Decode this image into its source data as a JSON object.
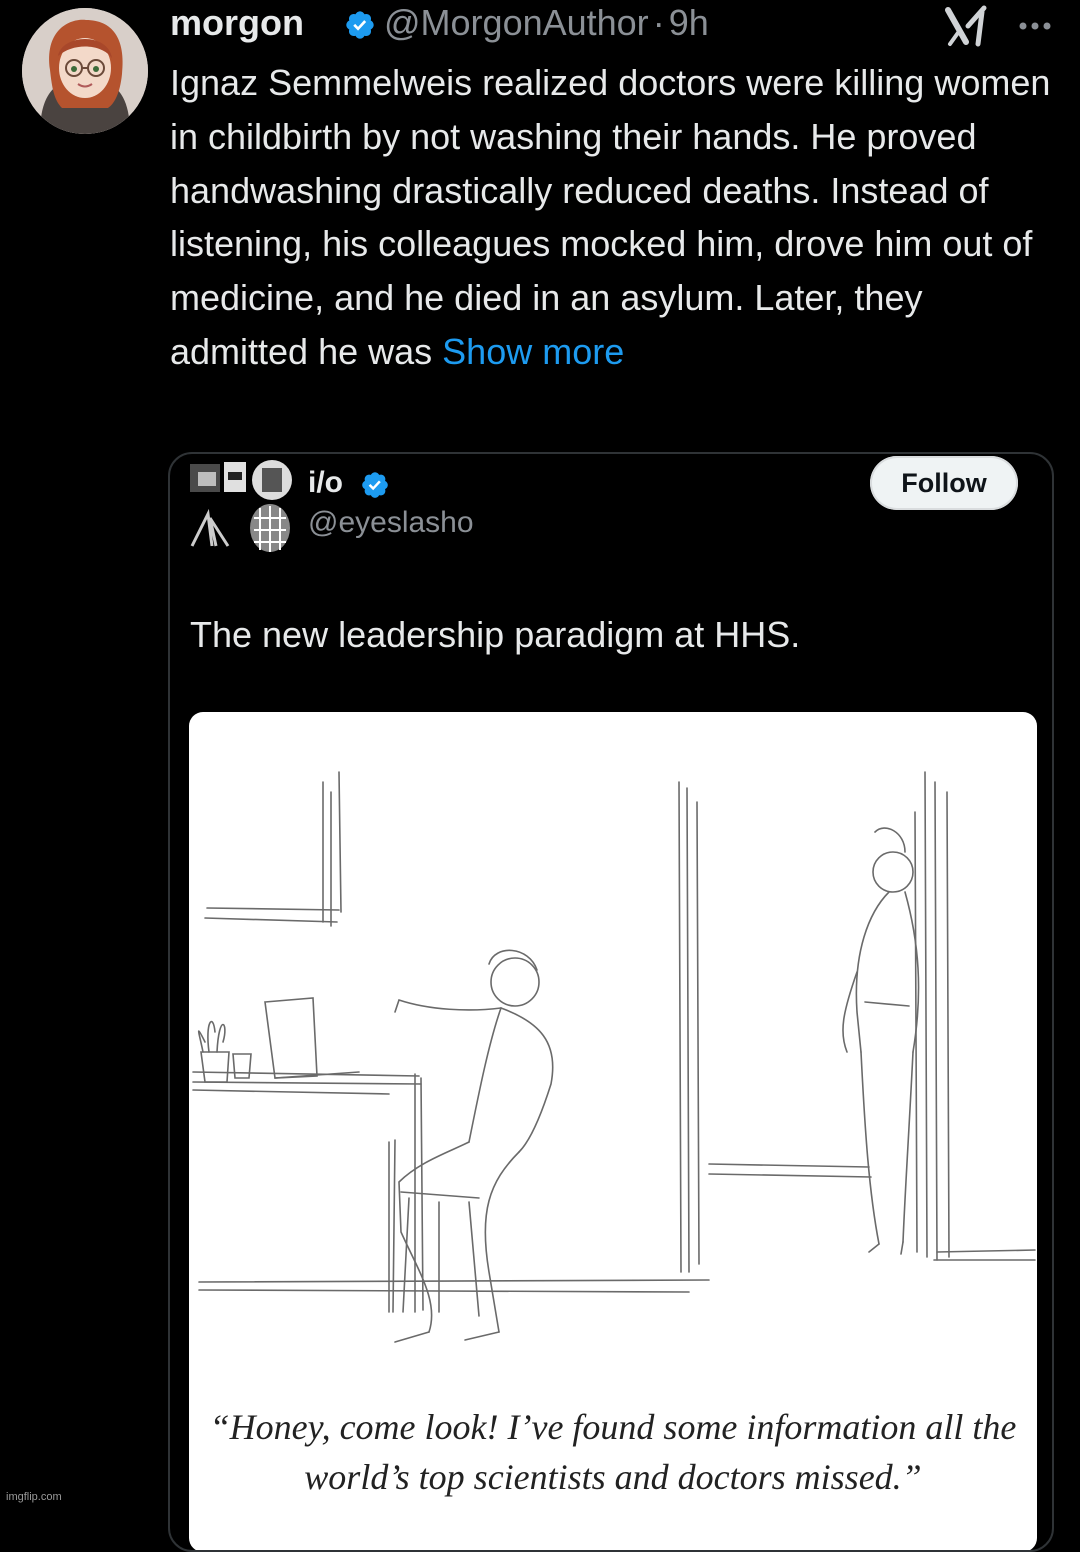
{
  "tweet": {
    "author_name": "morgon",
    "handle": "@MorgonAuthor",
    "separator": "·",
    "time": "9h",
    "text": "Ignaz Semmelweis realized doctors were killing women in childbirth by not washing their hands. He proved handwashing drastically reduced deaths. Instead of listening, his colleagues mocked him, drove him out of medicine, and he died in an asylum. Later, they admitted he was",
    "show_more": "Show more",
    "icons": [
      "verified-badge-icon",
      "grok-icon",
      "more-options-icon"
    ],
    "colors": {
      "link": "#1d9bf0",
      "verified": "#1d9bf0",
      "background": "#000000",
      "text": "#e7e9ea",
      "muted": "#8b9096"
    }
  },
  "quoted_post": {
    "author_name": "i/o",
    "handle": "@eyeslasho",
    "follow_label": "Follow",
    "text": "The new leadership paradigm at HHS.",
    "cartoon_caption": "“Honey, come look! I’ve found some information all the world’s top scientists and doctors missed.”"
  },
  "watermark": "imgflip.com"
}
